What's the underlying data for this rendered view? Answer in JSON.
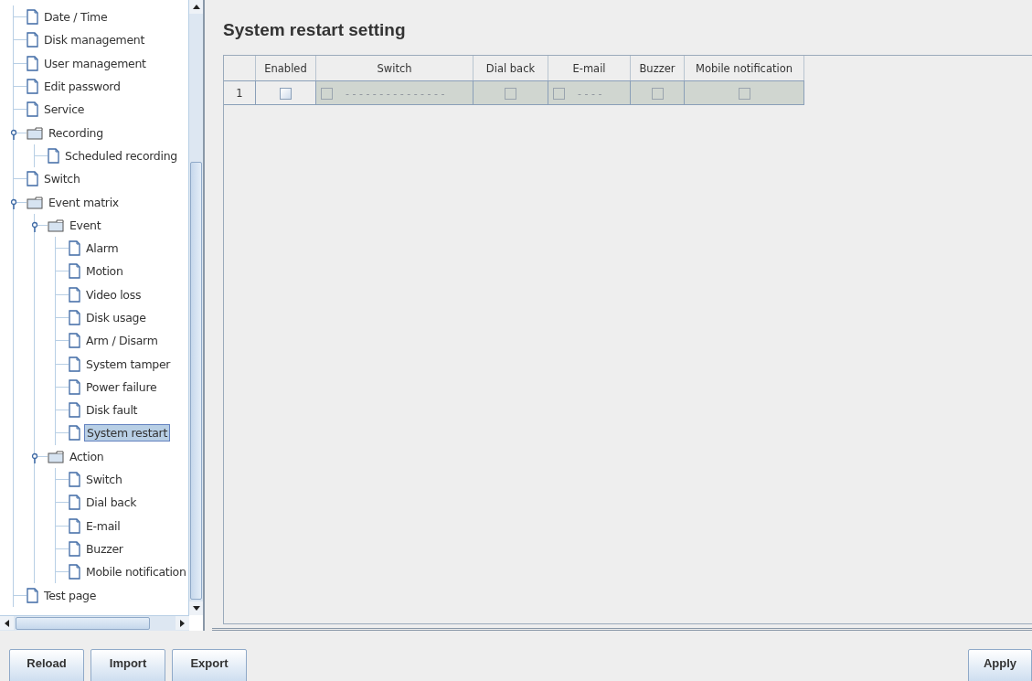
{
  "tree": [
    {
      "label": "Date / Time",
      "kind": "file",
      "selected": false
    },
    {
      "label": "Disk management",
      "kind": "file",
      "selected": false
    },
    {
      "label": "User management",
      "kind": "file",
      "selected": false
    },
    {
      "label": "Edit password",
      "kind": "file",
      "selected": false
    },
    {
      "label": "Service",
      "kind": "file",
      "selected": false
    },
    {
      "label": "Recording",
      "kind": "folder",
      "expanded": true,
      "selected": false,
      "children": [
        {
          "label": "Scheduled recording",
          "kind": "file",
          "selected": false
        }
      ]
    },
    {
      "label": "Switch",
      "kind": "file",
      "selected": false
    },
    {
      "label": "Event matrix",
      "kind": "folder",
      "expanded": true,
      "selected": false,
      "children": [
        {
          "label": "Event",
          "kind": "folder",
          "expanded": true,
          "selected": false,
          "children": [
            {
              "label": "Alarm",
              "kind": "file",
              "selected": false
            },
            {
              "label": "Motion",
              "kind": "file",
              "selected": false
            },
            {
              "label": "Video loss",
              "kind": "file",
              "selected": false
            },
            {
              "label": "Disk usage",
              "kind": "file",
              "selected": false
            },
            {
              "label": "Arm / Disarm",
              "kind": "file",
              "selected": false
            },
            {
              "label": "System tamper",
              "kind": "file",
              "selected": false
            },
            {
              "label": "Power failure",
              "kind": "file",
              "selected": false
            },
            {
              "label": "Disk fault",
              "kind": "file",
              "selected": false
            },
            {
              "label": "System restart",
              "kind": "file",
              "selected": true
            }
          ]
        },
        {
          "label": "Action",
          "kind": "folder",
          "expanded": true,
          "selected": false,
          "children": [
            {
              "label": "Switch",
              "kind": "file",
              "selected": false
            },
            {
              "label": "Dial back",
              "kind": "file",
              "selected": false
            },
            {
              "label": "E-mail",
              "kind": "file",
              "selected": false
            },
            {
              "label": "Buzzer",
              "kind": "file",
              "selected": false
            },
            {
              "label": "Mobile notification",
              "kind": "file",
              "selected": false
            }
          ]
        }
      ]
    },
    {
      "label": "Test page",
      "kind": "file",
      "selected": false
    }
  ],
  "title": "System restart setting",
  "table": {
    "columns": [
      "Enabled",
      "Switch",
      "Dial back",
      "E-mail",
      "Buzzer",
      "Mobile notification"
    ],
    "rows": [
      {
        "number": "1",
        "cells": [
          {
            "checked": false,
            "disabled": false
          },
          {
            "checked": false,
            "disabled": true,
            "value": "- - - - - - - - - - - - - - -"
          },
          {
            "checked": false,
            "disabled": true
          },
          {
            "checked": false,
            "disabled": true,
            "value": "- - - -"
          },
          {
            "checked": false,
            "disabled": true
          },
          {
            "checked": false,
            "disabled": true
          }
        ]
      }
    ]
  },
  "buttons_left": [
    "Reload",
    "Import",
    "Export"
  ],
  "buttons_right": [
    "Apply"
  ]
}
